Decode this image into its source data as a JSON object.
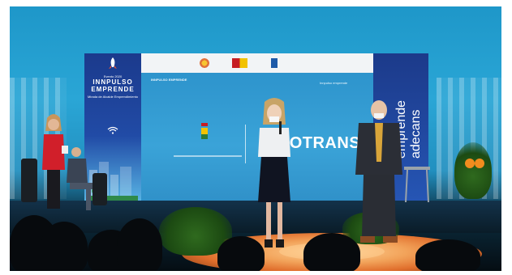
{
  "scene": {
    "description_free": true
  },
  "screen": {
    "headline": "LOTRANS",
    "small_brand": "INNPULSO EMPRENDE",
    "brand_tag": "Innpulso emprende"
  },
  "left_panel": {
    "event_label": "Evento 2020",
    "brand_line_1": "INNPULSO",
    "brand_line_2": "EMPRENDE",
    "tagline": "Mirada de Alcalde Emprendimiento",
    "wifi": "wifi-icon",
    "rocket": "rocket-icon"
  },
  "right_panel": {
    "vertical_1": "emprende",
    "vertical_2": "adecans"
  },
  "colors": {
    "backdrop": "#2aa6d6",
    "screen": "#3aa3d8",
    "stage_platform": "#f2a35a",
    "panel_blue": "#1c3a8a"
  }
}
